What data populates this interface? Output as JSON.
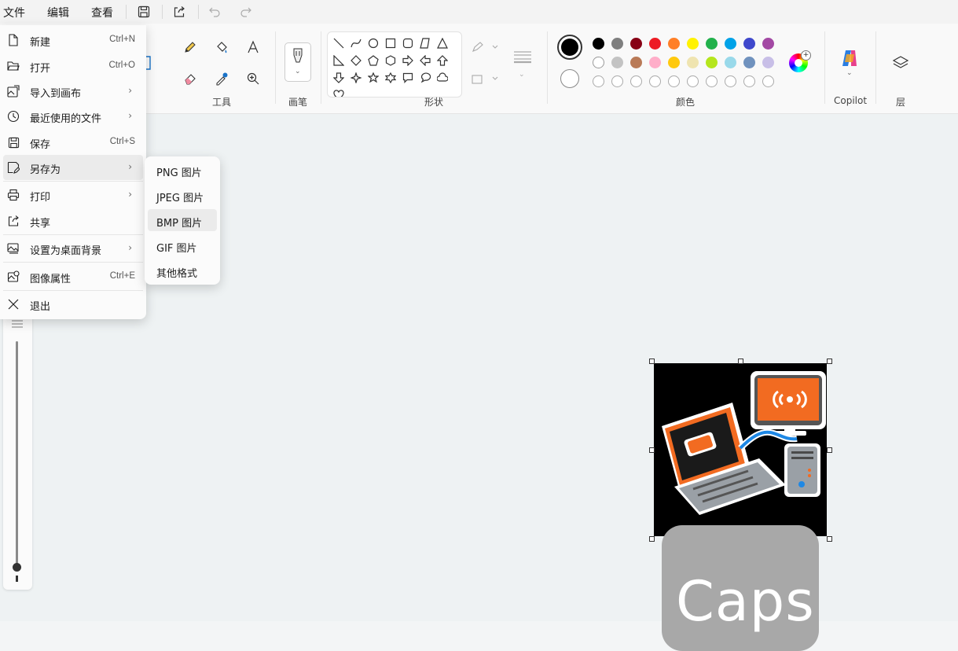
{
  "menubar": {
    "file": "文件",
    "edit": "编辑",
    "view": "查看"
  },
  "ribbon": {
    "tools_label": "工具",
    "brushes_label": "画笔",
    "shapes_label": "形状",
    "colors_label": "颜色",
    "copilot_label": "Copilot",
    "layers_label": "层"
  },
  "file_menu": {
    "items": [
      {
        "label": "新建",
        "shortcut": "Ctrl+N"
      },
      {
        "label": "打开",
        "shortcut": "Ctrl+O"
      },
      {
        "label": "导入到画布",
        "arrow": "›"
      },
      {
        "label": "最近使用的文件",
        "arrow": "›"
      },
      {
        "label": "保存",
        "shortcut": "Ctrl+S"
      },
      {
        "label": "另存为",
        "arrow": "›"
      },
      {
        "label": "打印",
        "arrow": "›"
      },
      {
        "label": "共享"
      },
      {
        "label": "设置为桌面背景",
        "arrow": "›"
      },
      {
        "label": "图像属性",
        "shortcut": "Ctrl+E"
      },
      {
        "label": "退出"
      }
    ]
  },
  "save_as_menu": {
    "items": [
      "PNG 图片",
      "JPEG 图片",
      "BMP 图片",
      "GIF 图片",
      "其他格式"
    ]
  },
  "colors": {
    "row1": [
      "#000000",
      "#7f7f7f",
      "#880015",
      "#ed1c24",
      "#ff7f27",
      "#fff200",
      "#22b14c",
      "#00a2e8",
      "#3f48cc",
      "#a349a4"
    ],
    "row2": [
      "#ffffff",
      "#c3c3c3",
      "#b97a57",
      "#ffaec9",
      "#ffc90e",
      "#efe4b0",
      "#b5e61d",
      "#99d9ea",
      "#7092be",
      "#c8bfe7"
    ],
    "primary": "#000000",
    "secondary": "#ffffff"
  },
  "canvas": {
    "overlay_text": "Caps"
  }
}
